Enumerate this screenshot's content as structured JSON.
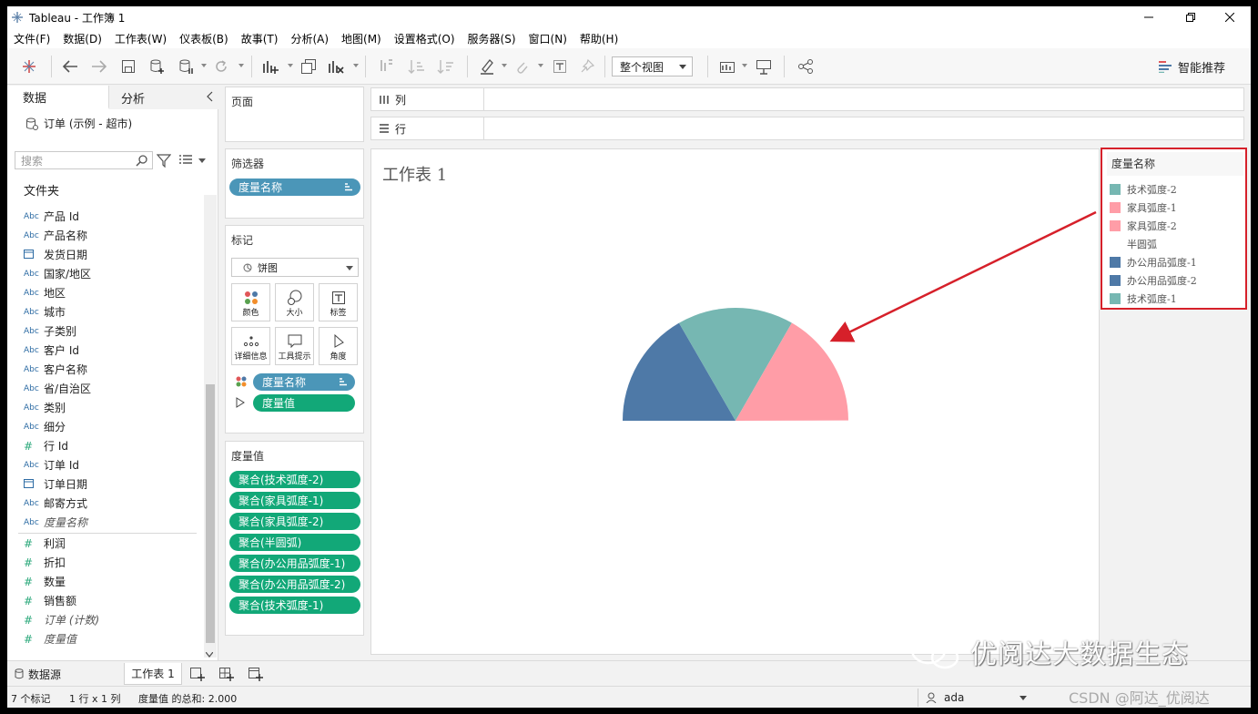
{
  "window": {
    "title": "Tableau - 工作簿 1"
  },
  "menu": [
    "文件(F)",
    "数据(D)",
    "工作表(W)",
    "仪表板(B)",
    "故事(T)",
    "分析(A)",
    "地图(M)",
    "设置格式(O)",
    "服务器(S)",
    "窗口(N)",
    "帮助(H)"
  ],
  "toolbar": {
    "view_mode": "整个视图",
    "smart_recommend": "智能推荐"
  },
  "datapane": {
    "tab_data": "数据",
    "tab_analysis": "分析",
    "datasource": "订单 (示例 - 超市)",
    "search_placeholder": "搜索",
    "folder_label": "文件夹",
    "dimensions": [
      {
        "type": "Abc",
        "name": "产品 Id"
      },
      {
        "type": "Abc",
        "name": "产品名称"
      },
      {
        "type": "date",
        "name": "发货日期"
      },
      {
        "type": "Abc",
        "name": "国家/地区"
      },
      {
        "type": "Abc",
        "name": "地区"
      },
      {
        "type": "Abc",
        "name": "城市"
      },
      {
        "type": "Abc",
        "name": "子类别"
      },
      {
        "type": "Abc",
        "name": "客户 Id"
      },
      {
        "type": "Abc",
        "name": "客户名称"
      },
      {
        "type": "Abc",
        "name": "省/自治区"
      },
      {
        "type": "Abc",
        "name": "类别"
      },
      {
        "type": "Abc",
        "name": "细分"
      },
      {
        "type": "#",
        "name": "行 Id"
      },
      {
        "type": "Abc",
        "name": "订单 Id"
      },
      {
        "type": "date",
        "name": "订单日期"
      },
      {
        "type": "Abc",
        "name": "邮寄方式"
      },
      {
        "type": "Abc",
        "name": "度量名称",
        "italic": true
      }
    ],
    "measures": [
      {
        "type": "#",
        "name": "利润"
      },
      {
        "type": "#",
        "name": "折扣"
      },
      {
        "type": "#",
        "name": "数量"
      },
      {
        "type": "#",
        "name": "销售额"
      },
      {
        "type": "#",
        "name": "订单 (计数)",
        "italic": true
      },
      {
        "type": "#",
        "name": "度量值",
        "italic": true
      }
    ]
  },
  "cards": {
    "pages": "页面",
    "filters": "筛选器",
    "filter_pill": "度量名称",
    "marks": "标记",
    "mark_type": "饼图",
    "mark_buttons": [
      "颜色",
      "大小",
      "标签",
      "详细信息",
      "工具提示",
      "角度"
    ],
    "color_pill": "度量名称",
    "angle_pill": "度量值",
    "values_title": "度量值",
    "values": [
      "聚合(技术弧度-2)",
      "聚合(家具弧度-1)",
      "聚合(家具弧度-2)",
      "聚合(半圆弧)",
      "聚合(办公用品弧度-1)",
      "聚合(办公用品弧度-2)",
      "聚合(技术弧度-1)"
    ]
  },
  "shelves": {
    "columns": "列",
    "rows": "行"
  },
  "sheet": {
    "title": "工作表 1"
  },
  "legend": {
    "title": "度量名称",
    "items": [
      {
        "label": "技术弧度-2",
        "color": "#76b7b2"
      },
      {
        "label": "家具弧度-1",
        "color": "#ff9da7"
      },
      {
        "label": "家具弧度-2",
        "color": "#ff9da7"
      },
      {
        "label": "半圆弧",
        "color": "#ffffff"
      },
      {
        "label": "办公用品弧度-1",
        "color": "#4e79a7"
      },
      {
        "label": "办公用品弧度-2",
        "color": "#4e79a7"
      },
      {
        "label": "技术弧度-1",
        "color": "#76b7b2"
      }
    ]
  },
  "chart_data": {
    "type": "pie",
    "note_shape": "half-pie (top semicircle visible)",
    "slices": [
      {
        "label": "办公用品",
        "share": 0.333,
        "color": "#4e79a7"
      },
      {
        "label": "技术",
        "share": 0.333,
        "color": "#76b7b2"
      },
      {
        "label": "家具",
        "share": 0.333,
        "color": "#ff9da7"
      },
      {
        "label": "半圆弧",
        "share": 1.0,
        "color": "#ffffff"
      }
    ]
  },
  "bottom": {
    "tab_datasource": "数据源",
    "tab_sheet": "工作表 1",
    "status_marks": "7 个标记",
    "status_rows": "1 行 x 1 列",
    "status_sum": "度量值 的总和: 2.000",
    "user": "ada"
  },
  "watermark": {
    "text": "优阅达大数据生态",
    "csdn": "CSDN @阿达_优阅达"
  }
}
